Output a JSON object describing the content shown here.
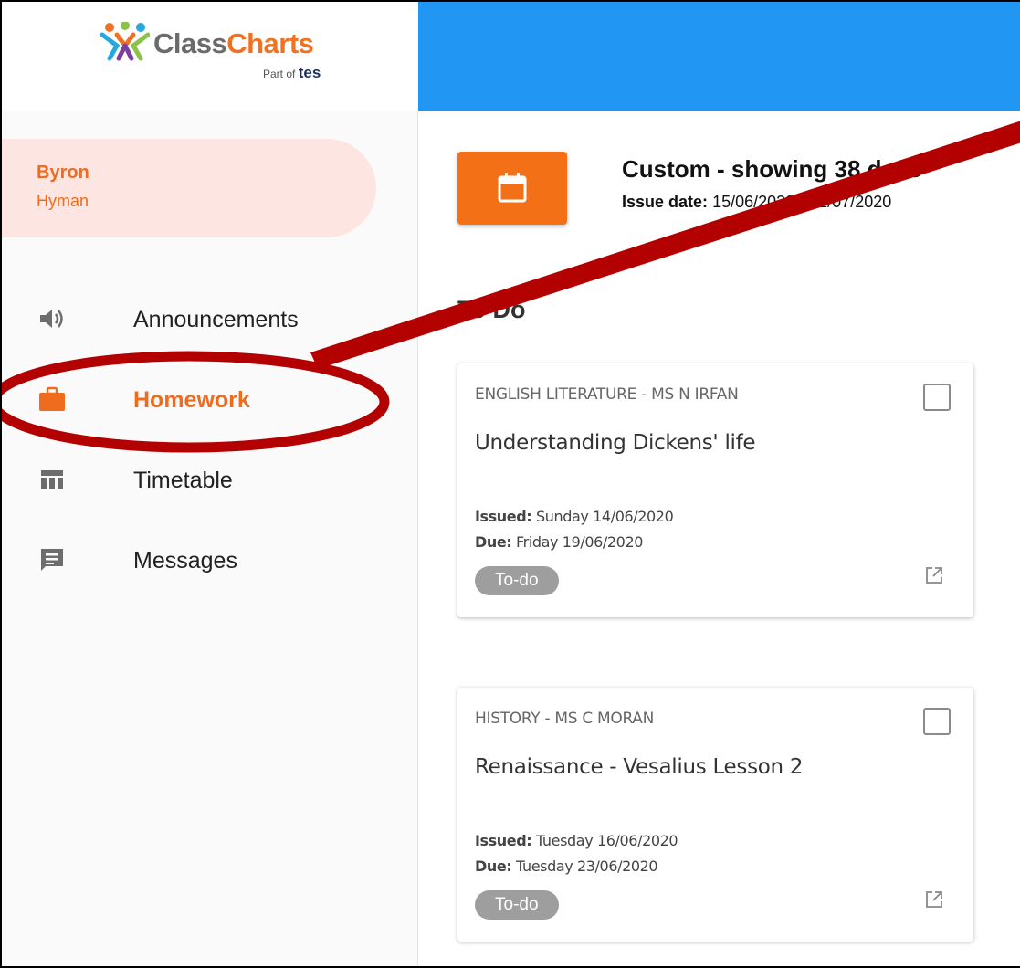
{
  "brand": {
    "name_part1": "Class",
    "name_part2": "Charts",
    "sub_prefix": "Part of",
    "sub_brand": "tes",
    "accent": "#f07122",
    "topbar_color": "#2196f3"
  },
  "profile": {
    "first_name": "Byron",
    "last_name": "Hyman"
  },
  "sidebar": {
    "items": [
      {
        "label": "Announcements",
        "icon": "speaker-icon",
        "active": false
      },
      {
        "label": "Homework",
        "icon": "briefcase-icon",
        "active": true
      },
      {
        "label": "Timetable",
        "icon": "timetable-icon",
        "active": false
      },
      {
        "label": "Messages",
        "icon": "message-icon",
        "active": false
      }
    ]
  },
  "filter": {
    "icon": "calendar-icon",
    "title": "Custom - showing 38 days",
    "issue_label": "Issue date:",
    "issue_range": "15/06/2020 - 22/07/2020"
  },
  "section": {
    "title": "To Do"
  },
  "homework": [
    {
      "subject": "ENGLISH LITERATURE - MS N IRFAN",
      "title": "Understanding Dickens' life",
      "issued_label": "Issued:",
      "issued": "Sunday 14/06/2020",
      "due_label": "Due:",
      "due": "Friday 19/06/2020",
      "status": "To-do"
    },
    {
      "subject": "HISTORY - MS C MORAN",
      "title": "Renaissance - Vesalius Lesson 2",
      "issued_label": "Issued:",
      "issued": "Tuesday 16/06/2020",
      "due_label": "Due:",
      "due": "Tuesday 23/06/2020",
      "status": "To-do"
    }
  ],
  "annotation": {
    "color": "#b30000"
  }
}
